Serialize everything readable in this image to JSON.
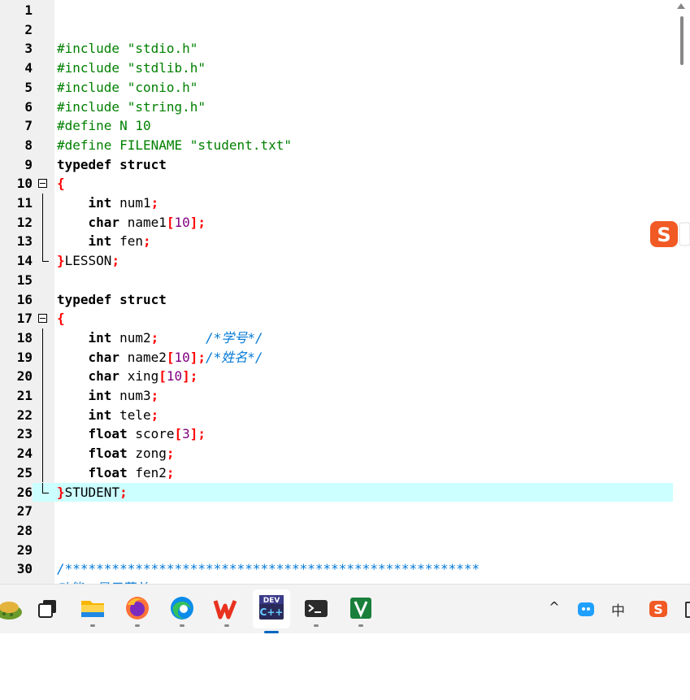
{
  "editor": {
    "lines": [
      {
        "n": "1",
        "tokens": []
      },
      {
        "n": "2",
        "tokens": []
      },
      {
        "n": "3",
        "tokens": [
          {
            "t": "#include \"stdio.h\"",
            "c": "pp"
          }
        ]
      },
      {
        "n": "4",
        "tokens": [
          {
            "t": "#include \"stdlib.h\"",
            "c": "pp"
          }
        ]
      },
      {
        "n": "5",
        "tokens": [
          {
            "t": "#include \"conio.h\"",
            "c": "pp"
          }
        ]
      },
      {
        "n": "6",
        "tokens": [
          {
            "t": "#include \"string.h\"",
            "c": "pp"
          }
        ]
      },
      {
        "n": "7",
        "tokens": [
          {
            "t": "#define N 10",
            "c": "pp"
          }
        ]
      },
      {
        "n": "8",
        "tokens": [
          {
            "t": "#define FILENAME \"student.txt\"",
            "c": "pp"
          }
        ]
      },
      {
        "n": "9",
        "tokens": [
          {
            "t": "typedef struct",
            "c": "kw"
          }
        ]
      },
      {
        "n": "10",
        "fold": "start",
        "tokens": [
          {
            "t": "{",
            "c": "sym"
          }
        ]
      },
      {
        "n": "11",
        "fold": "mid",
        "tokens": [
          {
            "t": "    "
          },
          {
            "t": "int",
            "c": "kw"
          },
          {
            "t": " num1"
          },
          {
            "t": ";",
            "c": "sym"
          }
        ]
      },
      {
        "n": "12",
        "fold": "mid",
        "tokens": [
          {
            "t": "    "
          },
          {
            "t": "char",
            "c": "kw"
          },
          {
            "t": " name1"
          },
          {
            "t": "[",
            "c": "sym"
          },
          {
            "t": "10",
            "c": "num"
          },
          {
            "t": "];",
            "c": "sym"
          }
        ]
      },
      {
        "n": "13",
        "fold": "mid",
        "tokens": [
          {
            "t": "    "
          },
          {
            "t": "int",
            "c": "kw"
          },
          {
            "t": " fen"
          },
          {
            "t": ";",
            "c": "sym"
          }
        ]
      },
      {
        "n": "14",
        "fold": "end",
        "tokens": [
          {
            "t": "}",
            "c": "sym"
          },
          {
            "t": "LESSON"
          },
          {
            "t": ";",
            "c": "sym"
          }
        ]
      },
      {
        "n": "15",
        "tokens": []
      },
      {
        "n": "16",
        "tokens": [
          {
            "t": "typedef struct",
            "c": "kw"
          }
        ]
      },
      {
        "n": "17",
        "fold": "start",
        "tokens": [
          {
            "t": "{",
            "c": "sym"
          }
        ]
      },
      {
        "n": "18",
        "fold": "mid",
        "tokens": [
          {
            "t": "    "
          },
          {
            "t": "int",
            "c": "kw"
          },
          {
            "t": " num2"
          },
          {
            "t": ";",
            "c": "sym"
          },
          {
            "t": "      "
          },
          {
            "t": "/*学号*/",
            "c": "cm"
          }
        ]
      },
      {
        "n": "19",
        "fold": "mid",
        "tokens": [
          {
            "t": "    "
          },
          {
            "t": "char",
            "c": "kw"
          },
          {
            "t": " name2"
          },
          {
            "t": "[",
            "c": "sym"
          },
          {
            "t": "10",
            "c": "num"
          },
          {
            "t": "];",
            "c": "sym"
          },
          {
            "t": "/*姓名*/",
            "c": "cm"
          }
        ]
      },
      {
        "n": "20",
        "fold": "mid",
        "tokens": [
          {
            "t": "    "
          },
          {
            "t": "char",
            "c": "kw"
          },
          {
            "t": " xing"
          },
          {
            "t": "[",
            "c": "sym"
          },
          {
            "t": "10",
            "c": "num"
          },
          {
            "t": "];",
            "c": "sym"
          }
        ]
      },
      {
        "n": "21",
        "fold": "mid",
        "tokens": [
          {
            "t": "    "
          },
          {
            "t": "int",
            "c": "kw"
          },
          {
            "t": " num3"
          },
          {
            "t": ";",
            "c": "sym"
          }
        ]
      },
      {
        "n": "22",
        "fold": "mid",
        "tokens": [
          {
            "t": "    "
          },
          {
            "t": "int",
            "c": "kw"
          },
          {
            "t": " tele"
          },
          {
            "t": ";",
            "c": "sym"
          }
        ]
      },
      {
        "n": "23",
        "fold": "mid",
        "tokens": [
          {
            "t": "    "
          },
          {
            "t": "float",
            "c": "kw"
          },
          {
            "t": " score"
          },
          {
            "t": "[",
            "c": "sym"
          },
          {
            "t": "3",
            "c": "num"
          },
          {
            "t": "];",
            "c": "sym"
          }
        ]
      },
      {
        "n": "24",
        "fold": "mid",
        "tokens": [
          {
            "t": "    "
          },
          {
            "t": "float",
            "c": "kw"
          },
          {
            "t": " zong"
          },
          {
            "t": ";",
            "c": "sym"
          }
        ]
      },
      {
        "n": "25",
        "fold": "mid",
        "tokens": [
          {
            "t": "    "
          },
          {
            "t": "float",
            "c": "kw"
          },
          {
            "t": " fen2"
          },
          {
            "t": ";",
            "c": "sym"
          }
        ]
      },
      {
        "n": "26",
        "fold": "end",
        "current": true,
        "tokens": [
          {
            "t": "}",
            "c": "sym"
          },
          {
            "t": "STUDENT"
          },
          {
            "t": ";",
            "c": "sym"
          }
        ]
      },
      {
        "n": "27",
        "tokens": []
      },
      {
        "n": "28",
        "tokens": []
      },
      {
        "n": "29",
        "tokens": []
      },
      {
        "n": "30",
        "tokens": [
          {
            "t": "/*****************************************************",
            "c": "cm"
          }
        ]
      },
      {
        "n": "",
        "tokens": [
          {
            "t": "功能：显示菜单",
            "c": "cm"
          }
        ]
      }
    ]
  },
  "colors": {
    "current_line": "#ccffff",
    "comment": "#0078d7",
    "preprocessor": "#008000",
    "symbol": "#ff0000",
    "number": "#800080"
  },
  "taskbar": {
    "apps": [
      "widgets-icon",
      "task-view-icon",
      "file-explorer-icon",
      "firefox-icon",
      "edge-icon",
      "wps-office-icon",
      "dev-cpp-icon",
      "terminal-icon",
      "vim-icon"
    ],
    "active_app": "dev-cpp-icon",
    "dev_cpp_label": "DEV",
    "tray": {
      "chevron": "^",
      "ime_label": "中"
    }
  }
}
